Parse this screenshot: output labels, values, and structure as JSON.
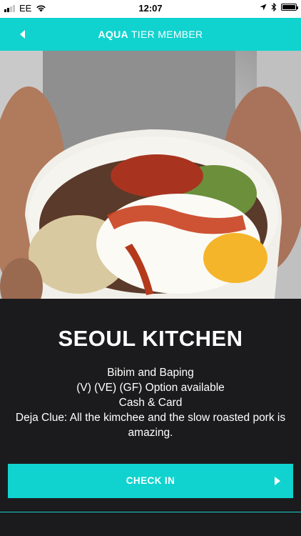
{
  "status_bar": {
    "carrier": "EE",
    "time": "12:07"
  },
  "header": {
    "tier_name": "AQUA",
    "tier_suffix": "TIER MEMBER"
  },
  "venue": {
    "name": "SEOUL KITCHEN",
    "details": [
      "Bibim and Baping",
      "(V) (VE) (GF) Option available",
      "Cash & Card",
      "Deja Clue: All the kimchee and the slow roasted pork is amazing."
    ]
  },
  "checkin": {
    "label": "CHECK IN"
  },
  "colors": {
    "accent": "#10d3cf",
    "background": "#1b1b1d"
  },
  "icons": {
    "back": "back-arrow-icon",
    "checkin": "play-arrow-icon",
    "wifi": "wifi-icon",
    "location": "location-icon",
    "bluetooth": "bluetooth-icon",
    "battery": "battery-icon"
  }
}
